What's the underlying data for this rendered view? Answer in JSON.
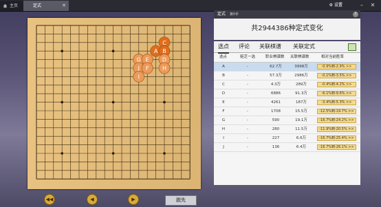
{
  "topbar": {
    "home_label": "主页",
    "joseki_tab_label": "定式",
    "tab_close": "✕",
    "settings_label": "设置",
    "minimize": "–",
    "close": "✕"
  },
  "panel_top": {
    "title": "定式",
    "subtitle": "第0手",
    "help": "?",
    "total_text": "共2944386种定式变化"
  },
  "panel_tabs": [
    "选点",
    "评论",
    "关联棋谱",
    "关联定式"
  ],
  "table_headers": [
    "选点",
    "赔芝一选",
    "职业棋谱数",
    "关联棋谱数",
    "相对当前胜率"
  ],
  "rows": [
    {
      "pt": "A",
      "v2": "-",
      "pro": "62.7万",
      "rel": "3998万",
      "rate": "-0.9%到-2.9% >>"
    },
    {
      "pt": "B",
      "v2": "-",
      "pro": "57.3万",
      "rel": "2986万",
      "rate": "-0.1%到-3.5% >>"
    },
    {
      "pt": "C",
      "v2": "-",
      "pro": "4.3万",
      "rel": "289万",
      "rate": "-0.4%到-4.2% >>"
    },
    {
      "pt": "D",
      "v2": "-",
      "pro": "6886",
      "rel": "91.3万",
      "rate": "-6.1%到-9.6% >>"
    },
    {
      "pt": "E",
      "v2": "-",
      "pro": "4261",
      "rel": "187万",
      "rate": "-3.4%到-5.3% >>"
    },
    {
      "pt": "F",
      "v2": "-",
      "pro": "1708",
      "rel": "15.5万",
      "rate": "-12.5%到-19.7% >>"
    },
    {
      "pt": "G",
      "v2": "-",
      "pro": "590",
      "rel": "19.1万",
      "rate": "-16.7%到-24.2% >>"
    },
    {
      "pt": "H",
      "v2": "-",
      "pro": "280",
      "rel": "11.5万",
      "rate": "-11.9%到-20.5% >>"
    },
    {
      "pt": "I",
      "v2": "-",
      "pro": "227",
      "rel": "6.6万",
      "rate": "-16.7%到-25.4% >>"
    },
    {
      "pt": "J",
      "v2": "-",
      "pro": "136",
      "rel": "6.4万",
      "rate": "-16.7%到-26.1% >>"
    }
  ],
  "board": {
    "markers": [
      {
        "label": "C",
        "col": 15,
        "row": 2,
        "strong": true
      },
      {
        "label": "A",
        "col": 14,
        "row": 3,
        "strong": true
      },
      {
        "label": "B",
        "col": 15,
        "row": 3,
        "strong": true
      },
      {
        "label": "G",
        "col": 12,
        "row": 4,
        "strong": false
      },
      {
        "label": "E",
        "col": 13,
        "row": 4,
        "strong": false
      },
      {
        "label": "D",
        "col": 15,
        "row": 4,
        "strong": false
      },
      {
        "label": "J",
        "col": 12,
        "row": 5,
        "strong": false
      },
      {
        "label": "F",
        "col": 13,
        "row": 5,
        "strong": false
      },
      {
        "label": "H",
        "col": 15,
        "row": 5,
        "strong": false
      },
      {
        "label": "I",
        "col": 12,
        "row": 6,
        "strong": false
      }
    ],
    "strong_color": "#e06d1c",
    "weak_color": "#ec9a5a"
  },
  "controls": {
    "first": "◀◀",
    "prev": "◀",
    "next": "▶",
    "pass_label": "脱先"
  }
}
